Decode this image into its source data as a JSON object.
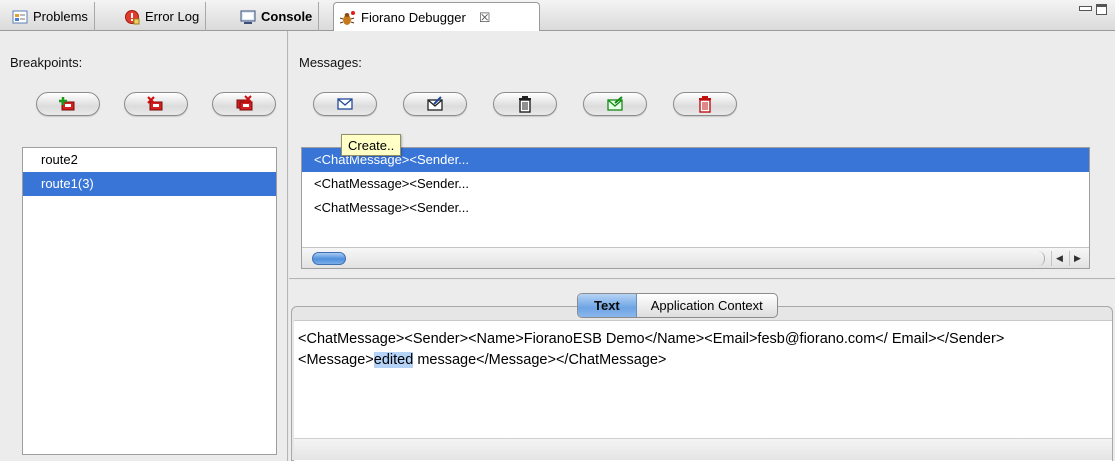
{
  "tabs": [
    {
      "label": "Problems",
      "icon": "problems-icon",
      "bold": false,
      "active": false
    },
    {
      "label": "Error Log",
      "icon": "error-log-icon",
      "bold": false,
      "active": false
    },
    {
      "label": "Console",
      "icon": "console-icon",
      "bold": true,
      "active": false
    },
    {
      "label": "Fiorano Debugger",
      "icon": "fiorano-debugger-icon",
      "bold": false,
      "active": true,
      "close": "☒"
    }
  ],
  "window_controls": [
    "minimize-icon",
    "maximize-icon"
  ],
  "breakpoints": {
    "title": "Breakpoints:",
    "buttons": [
      {
        "name": "add-breakpoint-button",
        "icon": "add-breakpoint-icon"
      },
      {
        "name": "remove-breakpoint-button",
        "icon": "remove-breakpoint-icon"
      },
      {
        "name": "remove-all-breakpoints-button",
        "icon": "remove-all-breakpoints-icon"
      }
    ],
    "items": [
      "route2",
      "route1(3)"
    ],
    "selected_index": 1
  },
  "messages": {
    "title": "Messages:",
    "buttons": [
      {
        "name": "create-message-button",
        "icon": "envelope-icon"
      },
      {
        "name": "edit-message-button",
        "icon": "edit-envelope-icon"
      },
      {
        "name": "delete-message-button",
        "icon": "trash-icon"
      },
      {
        "name": "send-message-button",
        "icon": "send-envelope-icon"
      },
      {
        "name": "delete-all-messages-button",
        "icon": "red-trash-icon"
      }
    ],
    "tooltip": "Create..",
    "items": [
      "<ChatMessage><Sender...",
      "<ChatMessage><Sender...",
      "<ChatMessage><Sender..."
    ],
    "selected_index": 0
  },
  "viewer": {
    "tabs": [
      "Text",
      "Application Context"
    ],
    "active_tab": 0,
    "text_before": "<ChatMessage><Sender><Name>FioranoESB Demo</Name><Email>fesb@fiorano.com</ Email></Sender><Message>",
    "text_highlight": "edited",
    "text_after": " message</Message></ChatMessage>"
  },
  "colors": {
    "selection": "#3875d7",
    "accent_blue": "#6ea4e4",
    "tooltip_bg": "#ffffc6"
  }
}
